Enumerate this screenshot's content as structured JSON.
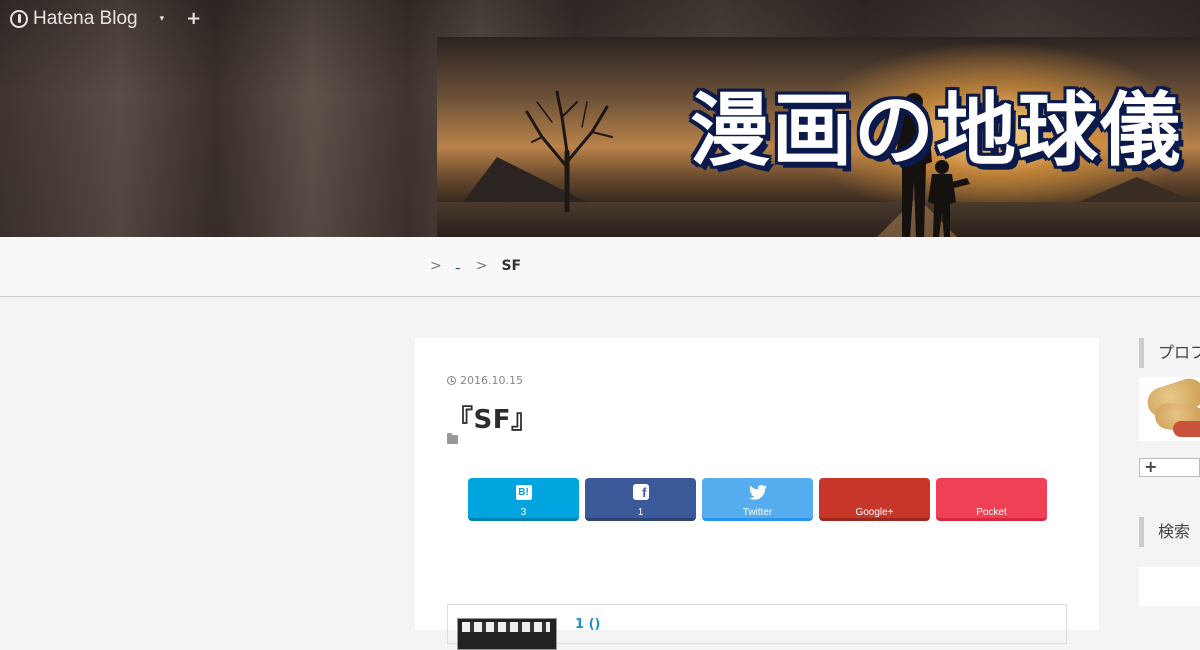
{
  "globalbar": {
    "brand": "Hatena Blog",
    "menu_caret": "▾",
    "add": "+"
  },
  "header": {
    "blog_title": "漫画の地球儀"
  },
  "breadcrumb": {
    "sep": ">",
    "parent": "_",
    "current": "SF"
  },
  "entry": {
    "date": "2016.10.15",
    "title": "『SF』",
    "related_title": "1 ()"
  },
  "share": [
    {
      "icon": "hatena-bookmark-icon",
      "icon_text": "B!",
      "label": "3"
    },
    {
      "icon": "facebook-icon",
      "icon_text": "f",
      "label": "1"
    },
    {
      "icon": "twitter-icon",
      "icon_text": "",
      "label": "Twitter"
    },
    {
      "icon": "google-plus-icon",
      "icon_text": "",
      "label": "Google+"
    },
    {
      "icon": "pocket-icon",
      "icon_text": "",
      "label": "Pocket"
    }
  ],
  "sidebar": {
    "profile_heading": "プロフィール",
    "follow_label": "+",
    "search_heading": "検索"
  },
  "colors": {
    "hatena": "#00a4de",
    "facebook": "#3b5998",
    "twitter": "#55acee",
    "google_plus": "#c6372a",
    "pocket": "#ef4056",
    "title_outline": "#0b1a4a"
  }
}
